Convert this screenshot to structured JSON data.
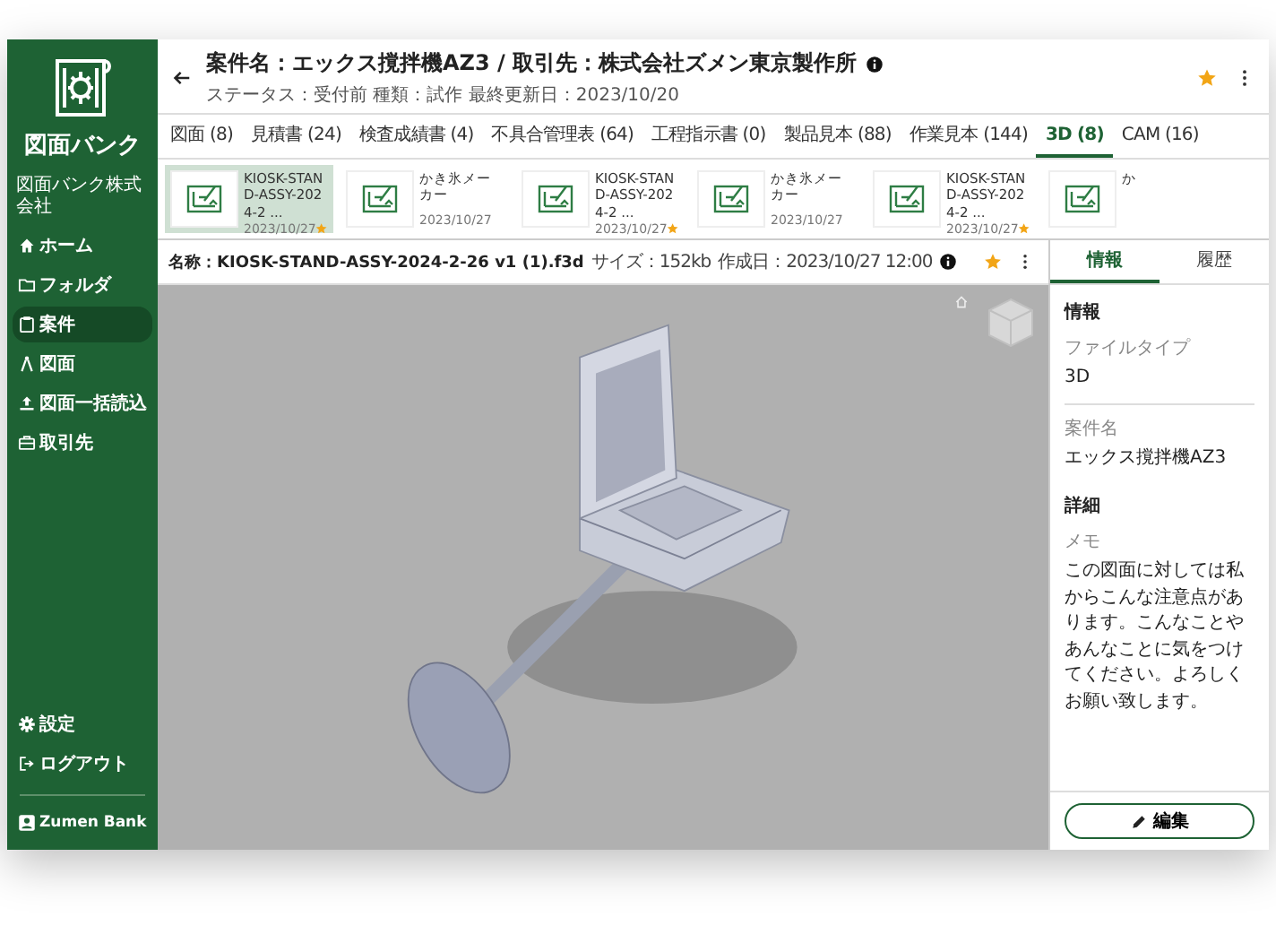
{
  "sidebar": {
    "logo_text": "図面バンク",
    "company": "図面バンク株式会社",
    "nav": [
      {
        "label": "ホーム",
        "kind": "home",
        "selected": false
      },
      {
        "label": "フォルダ",
        "kind": "folder",
        "selected": false
      },
      {
        "label": "案件",
        "kind": "clipboard",
        "selected": true
      },
      {
        "label": "図面",
        "kind": "compass",
        "selected": false
      },
      {
        "label": "図面一括読込",
        "kind": "upload",
        "selected": false
      },
      {
        "label": "取引先",
        "kind": "briefcase",
        "selected": false
      }
    ],
    "bottom": [
      {
        "label": "設定",
        "kind": "gear"
      },
      {
        "label": "ログアウト",
        "kind": "logout"
      }
    ],
    "user": {
      "name": "Zumen Bank"
    }
  },
  "header": {
    "title": "案件名：エックス撹拌機AZ3 / 取引先：株式会社ズメン東京製作所",
    "subtitle": "ステータス：受付前 種類：試作 最終更新日：2023/10/20",
    "starred": true
  },
  "tabs": [
    {
      "label": "図面 (8)",
      "selected": false
    },
    {
      "label": "見積書 (24)",
      "selected": false
    },
    {
      "label": "検査成績書 (4)",
      "selected": false
    },
    {
      "label": "不具合管理表 (64)",
      "selected": false
    },
    {
      "label": "工程指示書 (0)",
      "selected": false
    },
    {
      "label": "製品見本 (88)",
      "selected": false
    },
    {
      "label": "作業見本 (144)",
      "selected": false
    },
    {
      "label": "3D (8)",
      "selected": true
    },
    {
      "label": "CAM (16)",
      "selected": false
    }
  ],
  "thumbnails": [
    {
      "title": "KIOSK-STAND-ASSY-2024-2 ...",
      "date": "2023/10/27",
      "starred": true,
      "selected": true
    },
    {
      "title": "かき氷メーカー",
      "date": "2023/10/27",
      "starred": false,
      "selected": false
    },
    {
      "title": "KIOSK-STAND-ASSY-2024-2 ...",
      "date": "2023/10/27",
      "starred": true,
      "selected": false
    },
    {
      "title": "かき氷メーカー",
      "date": "2023/10/27",
      "starred": false,
      "selected": false
    },
    {
      "title": "KIOSK-STAND-ASSY-2024-2 ...",
      "date": "2023/10/27",
      "starred": true,
      "selected": false
    },
    {
      "title": "か",
      "starred": false,
      "selected": false
    }
  ],
  "file": {
    "name": "名称：KIOSK-STAND-ASSY-2024-2-26 v1 (1).f3d",
    "size": "サイズ：152kb",
    "created": "作成日：2023/10/27 12:00",
    "starred": true
  },
  "panel": {
    "tabs": [
      {
        "label": "情報",
        "selected": true
      },
      {
        "label": "履歴",
        "selected": false
      }
    ],
    "sections": [
      {
        "heading": "情報",
        "fields": [
          {
            "label": "ファイルタイプ",
            "value": "3D"
          },
          {
            "label": "案件名",
            "value": "エックス撹拌機AZ3"
          }
        ]
      },
      {
        "heading": "詳細",
        "fields": [
          {
            "label": "メモ",
            "value": "この図面に対しては私からこんな注意点があります。こんなことやあんなことに気をつけてください。よろしくお願い致します。"
          }
        ]
      }
    ],
    "edit_button": "編集"
  }
}
